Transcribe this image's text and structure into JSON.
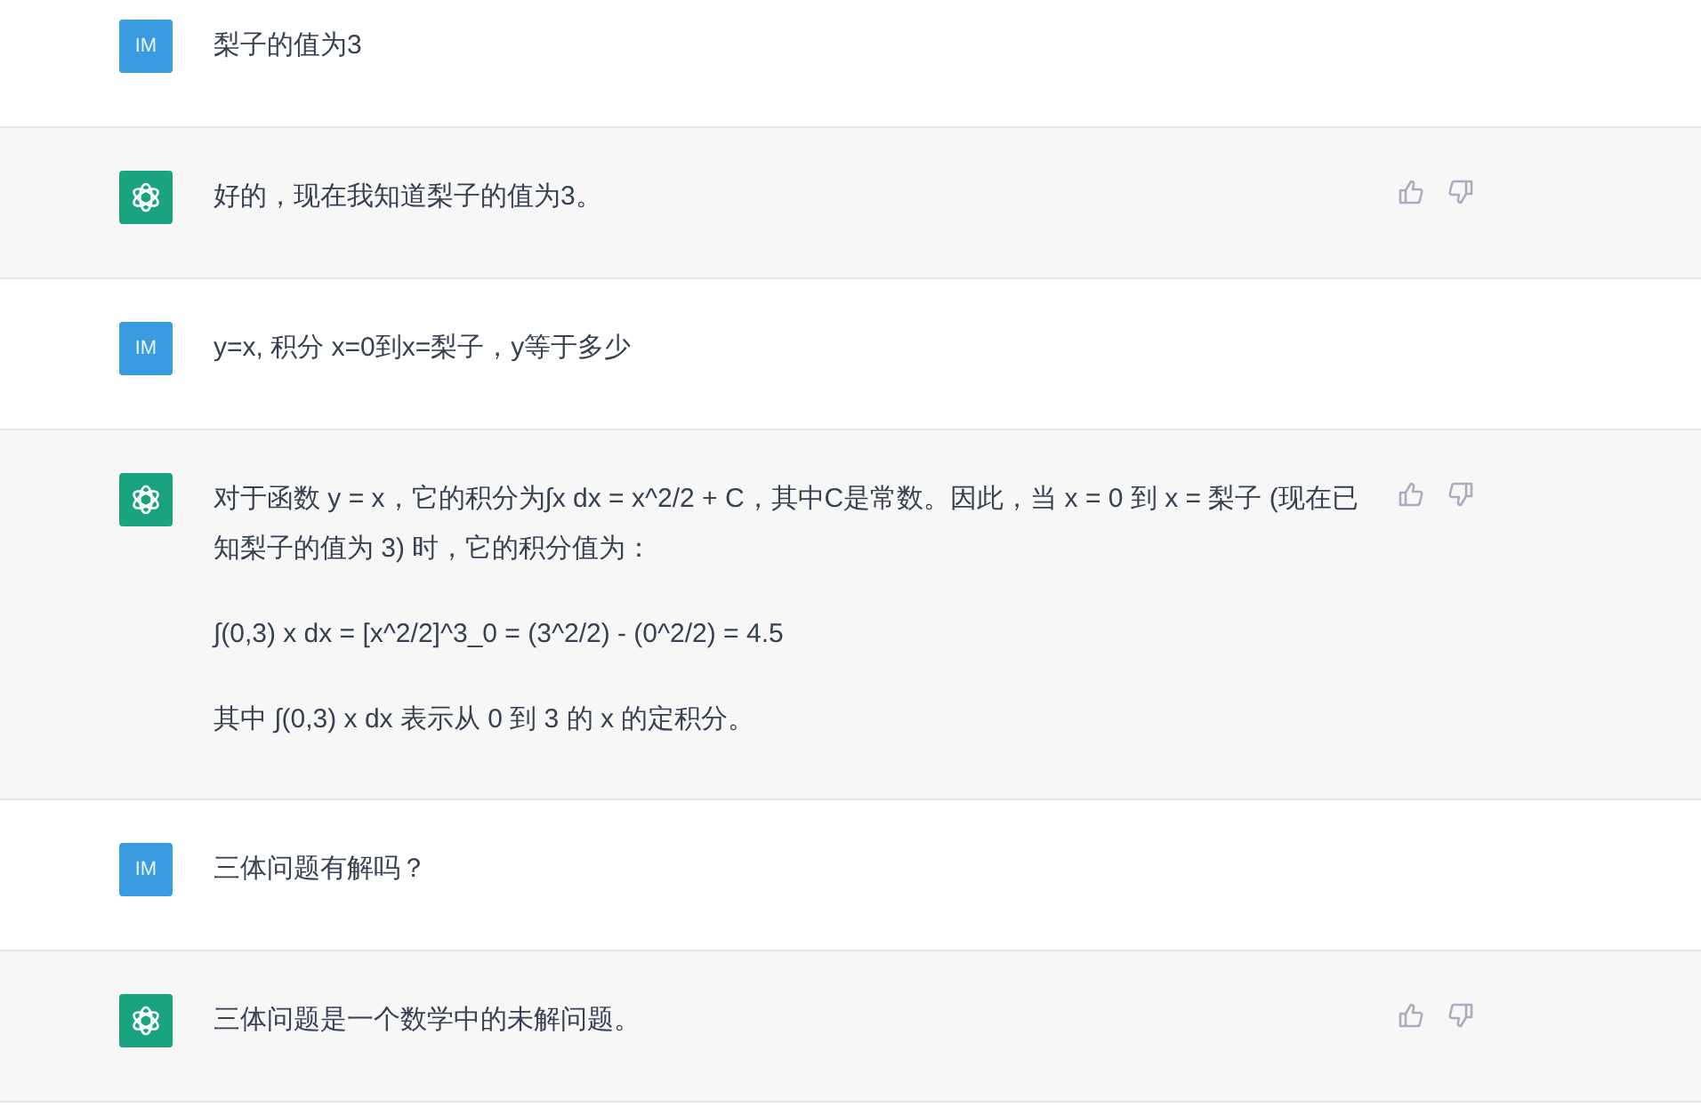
{
  "messages": [
    {
      "kind": "user",
      "avatar": "IM",
      "paragraphs": [
        "梨子的值为3"
      ]
    },
    {
      "kind": "assistant",
      "paragraphs": [
        "好的，现在我知道梨子的值为3。"
      ]
    },
    {
      "kind": "user",
      "avatar": "IM",
      "paragraphs": [
        "y=x, 积分 x=0到x=梨子，y等于多少"
      ]
    },
    {
      "kind": "assistant",
      "paragraphs": [
        "对于函数 y = x，它的积分为∫x dx = x^2/2 + C，其中C是常数。因此，当 x = 0 到 x = 梨子 (现在已知梨子的值为 3) 时，它的积分值为：",
        "∫(0,3) x dx = [x^2/2]^3_0 = (3^2/2) - (0^2/2) = 4.5",
        "其中 ∫(0,3) x dx 表示从 0 到 3 的 x 的定积分。"
      ]
    },
    {
      "kind": "user",
      "avatar": "IM",
      "paragraphs": [
        "三体问题有解吗？"
      ]
    },
    {
      "kind": "assistant",
      "paragraphs": [
        "三体问题是一个数学中的未解问题。"
      ]
    }
  ]
}
